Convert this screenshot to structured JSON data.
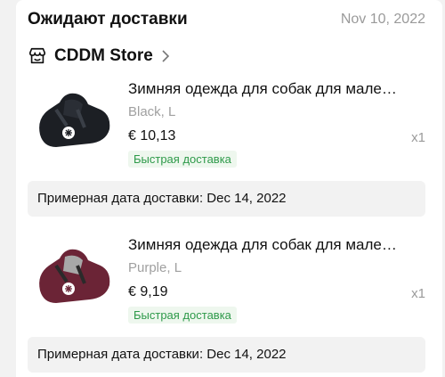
{
  "header": {
    "title": "Ожидают доставки",
    "date": "Nov 10, 2022"
  },
  "store": {
    "name": "CDDM Store",
    "icon": "store-icon"
  },
  "items": [
    {
      "title": "Зимняя одежда для собак для мале…",
      "variant": "Black, L",
      "price": "€ 10,13",
      "qty": "x1",
      "badge": "Быстрая доставка",
      "color": "#1c1f24",
      "estimate": "Примерная дата доставки: Dec 14, 2022"
    },
    {
      "title": "Зимняя одежда для собак для мале…",
      "variant": "Purple, L",
      "price": "€ 9,19",
      "qty": "x1",
      "badge": "Быстрая доставка",
      "color": "#6b2436",
      "estimate": "Примерная дата доставки: Dec 14, 2022"
    }
  ],
  "colors": {
    "badge_text": "#2e9a4a",
    "badge_bg": "#eef7ee",
    "muted": "#9a9a9a"
  }
}
